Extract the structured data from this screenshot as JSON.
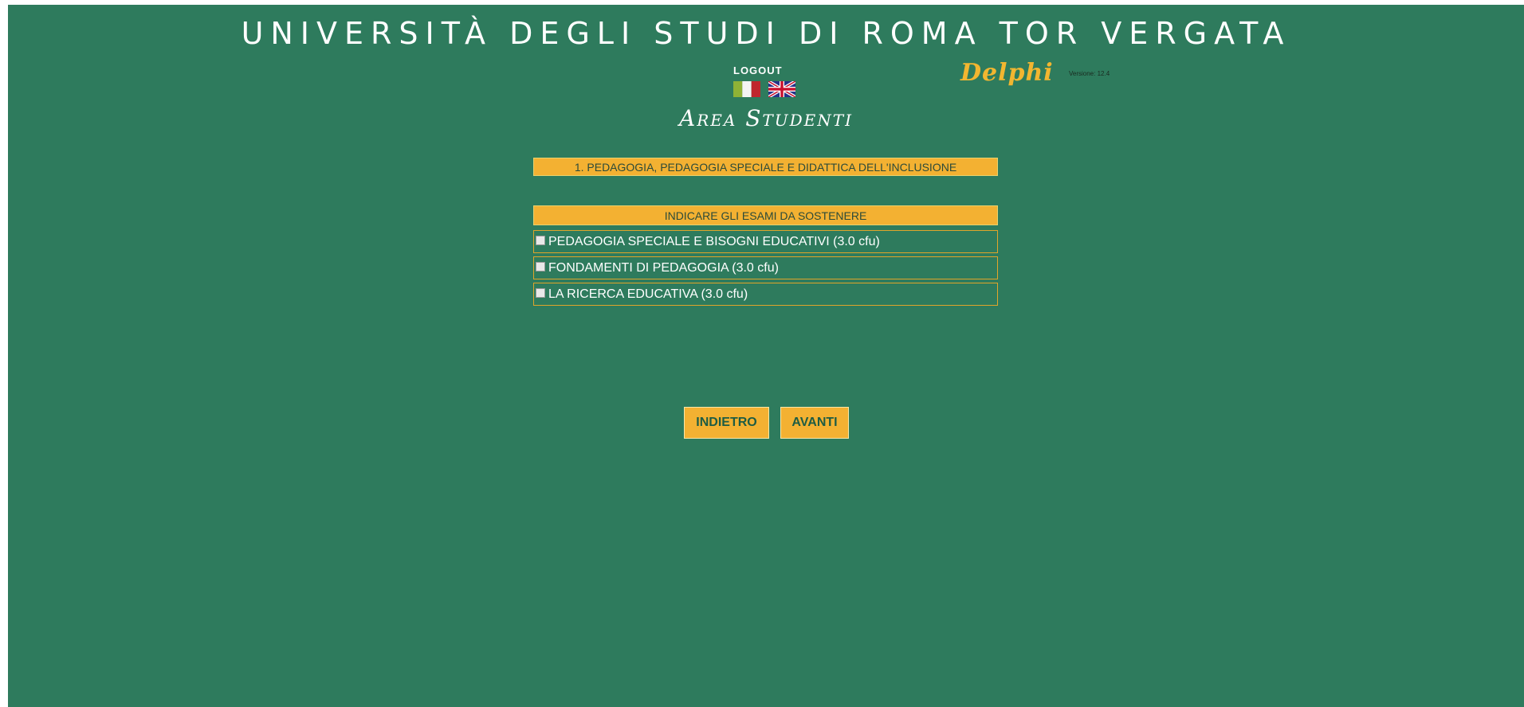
{
  "header": {
    "university": "UNIVERSITÀ DEGLI STUDI DI ROMA TOR VERGATA",
    "logout": "LOGOUT",
    "brand": "Delphi",
    "version": "Versione: 12.4",
    "area": "Area Studenti"
  },
  "languages": [
    {
      "code": "it",
      "icon": "italian-flag-icon"
    },
    {
      "code": "en",
      "icon": "english-flag-icon"
    }
  ],
  "course": {
    "title": "1. PEDAGOGIA, PEDAGOGIA SPECIALE E DIDATTICA DELL'INCLUSIONE"
  },
  "exams": {
    "header": "INDICARE GLI ESAMI DA SOSTENERE",
    "items": [
      {
        "label": "PEDAGOGIA SPECIALE E BISOGNI EDUCATIVI (3.0 cfu)",
        "checked": false
      },
      {
        "label": "FONDAMENTI DI PEDAGOGIA (3.0 cfu)",
        "checked": false
      },
      {
        "label": "LA RICERCA EDUCATIVA (3.0 cfu)",
        "checked": false
      }
    ]
  },
  "buttons": {
    "back": "INDIETRO",
    "next": "AVANTI"
  },
  "colors": {
    "background": "#2e7b5d",
    "accent": "#f3b132",
    "text": "#ffffff"
  }
}
